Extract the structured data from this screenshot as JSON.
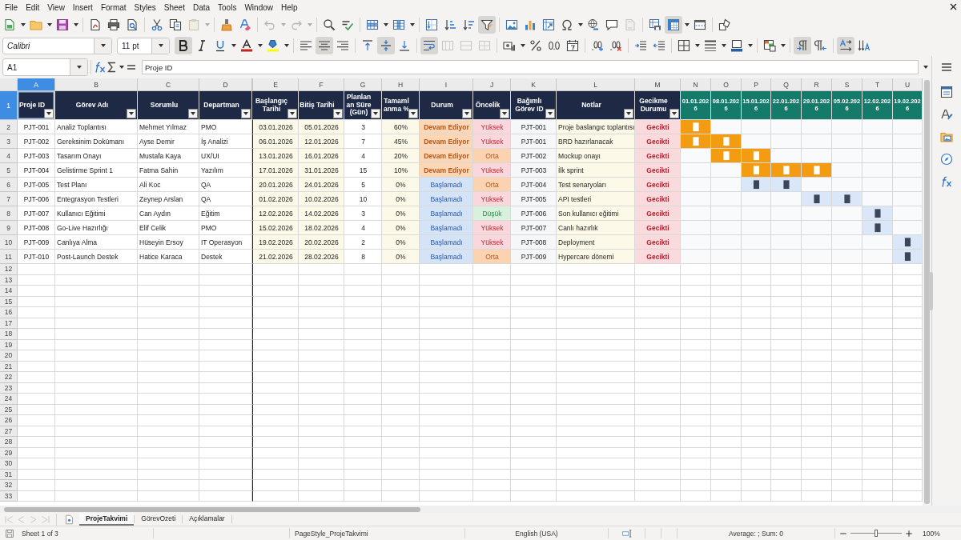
{
  "menu": [
    "File",
    "Edit",
    "View",
    "Insert",
    "Format",
    "Styles",
    "Sheet",
    "Data",
    "Tools",
    "Window",
    "Help"
  ],
  "standard_toolbar": {
    "paste_disabled": true,
    "undo_disabled": true,
    "redo_disabled": true,
    "header_footer_disabled": true,
    "autofilter_on": true,
    "freeze_on": true
  },
  "formatting_toolbar": {
    "font_name": "Calibri",
    "font_size": "11 pt",
    "bold_on": true,
    "align_center_on": true,
    "valign_middle_on": true,
    "wrap_text_on": true,
    "merge_disabled": true,
    "merge_center_disabled": true,
    "unmerge_disabled": true,
    "left_to_right_on": true,
    "text_flow_on": true
  },
  "formula_bar": {
    "name_box": "A1",
    "content": "Proje ID"
  },
  "sheet": {
    "column_headers": [
      {
        "label": "A",
        "selected": true
      },
      {
        "label": "B",
        "selected": false
      },
      {
        "label": "C",
        "selected": false
      },
      {
        "label": "D",
        "selected": false
      },
      {
        "label": "E",
        "selected": false
      },
      {
        "label": "F",
        "selected": false
      },
      {
        "label": "G",
        "selected": false
      },
      {
        "label": "H",
        "selected": false
      },
      {
        "label": "I",
        "selected": false
      },
      {
        "label": "J",
        "selected": false
      },
      {
        "label": "K",
        "selected": false
      },
      {
        "label": "L",
        "selected": false
      },
      {
        "label": "M",
        "selected": false
      },
      {
        "label": "N",
        "selected": false
      },
      {
        "label": "O",
        "selected": false
      },
      {
        "label": "P",
        "selected": false
      },
      {
        "label": "Q",
        "selected": false
      },
      {
        "label": "R",
        "selected": false
      },
      {
        "label": "S",
        "selected": false
      },
      {
        "label": "T",
        "selected": false
      },
      {
        "label": "U",
        "selected": false
      }
    ],
    "row_headers": [
      {
        "label": "1",
        "selected": true
      },
      {
        "label": "2",
        "selected": false
      },
      {
        "label": "3",
        "selected": false
      },
      {
        "label": "4",
        "selected": false
      },
      {
        "label": "5",
        "selected": false
      },
      {
        "label": "6",
        "selected": false
      },
      {
        "label": "7",
        "selected": false
      },
      {
        "label": "8",
        "selected": false
      },
      {
        "label": "9",
        "selected": false
      },
      {
        "label": "10",
        "selected": false
      },
      {
        "label": "11",
        "selected": false
      },
      {
        "label": "12",
        "selected": false
      },
      {
        "label": "13",
        "selected": false
      },
      {
        "label": "14",
        "selected": false
      },
      {
        "label": "15",
        "selected": false
      },
      {
        "label": "16",
        "selected": false
      },
      {
        "label": "17",
        "selected": false
      },
      {
        "label": "18",
        "selected": false
      },
      {
        "label": "19",
        "selected": false
      },
      {
        "label": "20",
        "selected": false
      },
      {
        "label": "21",
        "selected": false
      },
      {
        "label": "22",
        "selected": false
      },
      {
        "label": "23",
        "selected": false
      },
      {
        "label": "24",
        "selected": false
      },
      {
        "label": "25",
        "selected": false
      },
      {
        "label": "26",
        "selected": false
      },
      {
        "label": "27",
        "selected": false
      },
      {
        "label": "28",
        "selected": false
      },
      {
        "label": "29",
        "selected": false
      },
      {
        "label": "30",
        "selected": false
      },
      {
        "label": "31",
        "selected": false
      },
      {
        "label": "32",
        "selected": false
      },
      {
        "label": "33",
        "selected": false
      }
    ],
    "header_row": [
      {
        "text": "Proje ID",
        "kind": "field"
      },
      {
        "text": "Görev Adı",
        "kind": "field"
      },
      {
        "text": "Sorumlu",
        "kind": "field"
      },
      {
        "text": "Departman",
        "kind": "field"
      },
      {
        "text": "Başlangıç Tarihi",
        "kind": "field"
      },
      {
        "text": "Bitiş Tarihi",
        "kind": "field"
      },
      {
        "text": "Planlanan Süre (Gün)",
        "kind": "field"
      },
      {
        "text": "Tamamlanma %",
        "kind": "field"
      },
      {
        "text": "Durum",
        "kind": "field"
      },
      {
        "text": "Öncelik",
        "kind": "field"
      },
      {
        "text": "Bağımlı Görev ID",
        "kind": "field"
      },
      {
        "text": "Notlar",
        "kind": "field"
      },
      {
        "text": "Gecikme Durumu",
        "kind": "field"
      },
      {
        "text": "01.01.2026",
        "kind": "week"
      },
      {
        "text": "08.01.2026",
        "kind": "week"
      },
      {
        "text": "15.01.2026",
        "kind": "week"
      },
      {
        "text": "22.01.2026",
        "kind": "week"
      },
      {
        "text": "29.01.2026",
        "kind": "week"
      },
      {
        "text": "05.02.2026",
        "kind": "week"
      },
      {
        "text": "12.02.2026",
        "kind": "week"
      },
      {
        "text": "19.02.2026",
        "kind": "week"
      }
    ],
    "rows": [
      {
        "id": "PJT-001",
        "task": "Analiz Toplantısı",
        "owner": "Mehmet Yılmaz",
        "department": "PMO",
        "start": "03.01.2026",
        "end": "05.01.2026",
        "duration": "3",
        "progress": "60%",
        "status": {
          "text": "Devam Ediyor",
          "kind": "in_progress"
        },
        "priority": {
          "text": "Yüksek",
          "kind": "high"
        },
        "depends_on": "PJT-001",
        "note": "Proje baslangıc toplantısı",
        "delay": "Gecikti",
        "timeline": [
          {
            "filled": true,
            "text": "█"
          },
          {
            "filled": false
          },
          {
            "filled": false
          },
          {
            "filled": false
          },
          {
            "filled": false
          },
          {
            "filled": false
          },
          {
            "filled": false
          },
          {
            "filled": false
          }
        ]
      },
      {
        "id": "PJT-002",
        "task": "Gereksinim Dokümanı",
        "owner": "Ayse Demir",
        "department": "İş Analizi",
        "start": "06.01.2026",
        "end": "12.01.2026",
        "duration": "7",
        "progress": "45%",
        "status": {
          "text": "Devam Ediyor",
          "kind": "in_progress"
        },
        "priority": {
          "text": "Yüksek",
          "kind": "high"
        },
        "depends_on": "PJT-001",
        "note": "BRD hazırlanacak",
        "delay": "Gecikti",
        "timeline": [
          {
            "filled": true,
            "text": "█"
          },
          {
            "filled": true,
            "text": "█"
          },
          {
            "filled": false
          },
          {
            "filled": false
          },
          {
            "filled": false
          },
          {
            "filled": false
          },
          {
            "filled": false
          },
          {
            "filled": false
          }
        ]
      },
      {
        "id": "PJT-003",
        "task": "Tasarım Onayı",
        "owner": "Mustafa Kaya",
        "department": "UX/UI",
        "start": "13.01.2026",
        "end": "16.01.2026",
        "duration": "4",
        "progress": "20%",
        "status": {
          "text": "Devam Ediyor",
          "kind": "in_progress"
        },
        "priority": {
          "text": "Orta",
          "kind": "medium"
        },
        "depends_on": "PJT-002",
        "note": "Mockup onayı",
        "delay": "Gecikti",
        "timeline": [
          {
            "filled": false
          },
          {
            "filled": true,
            "text": "█"
          },
          {
            "filled": true,
            "text": "█"
          },
          {
            "filled": false
          },
          {
            "filled": false
          },
          {
            "filled": false
          },
          {
            "filled": false
          },
          {
            "filled": false
          }
        ]
      },
      {
        "id": "PJT-004",
        "task": "Gelistirme Sprint 1",
        "owner": "Fatma Sahin",
        "department": "Yazılım",
        "start": "17.01.2026",
        "end": "31.01.2026",
        "duration": "15",
        "progress": "10%",
        "status": {
          "text": "Devam Ediyor",
          "kind": "in_progress"
        },
        "priority": {
          "text": "Yüksek",
          "kind": "high"
        },
        "depends_on": "PJT-003",
        "note": "İlk sprint",
        "delay": "Gecikti",
        "timeline": [
          {
            "filled": false
          },
          {
            "filled": false
          },
          {
            "filled": true,
            "text": "█"
          },
          {
            "filled": true,
            "text": "█"
          },
          {
            "filled": true,
            "text": "█"
          },
          {
            "filled": false
          },
          {
            "filled": false
          },
          {
            "filled": false
          }
        ]
      },
      {
        "id": "PJT-005",
        "task": "Test Planı",
        "owner": "Ali Koc",
        "department": "QA",
        "start": "20.01.2026",
        "end": "24.01.2026",
        "duration": "5",
        "progress": "0%",
        "status": {
          "text": "Başlamadı",
          "kind": "not_started"
        },
        "priority": {
          "text": "Orta",
          "kind": "medium"
        },
        "depends_on": "PJT-004",
        "note": "Test senaryoları",
        "delay": "Gecikti",
        "timeline": [
          {
            "filled": false
          },
          {
            "filled": false
          },
          {
            "filled": true,
            "text": "█"
          },
          {
            "filled": true,
            "text": "█"
          },
          {
            "filled": false
          },
          {
            "filled": false
          },
          {
            "filled": false
          },
          {
            "filled": false
          }
        ]
      },
      {
        "id": "PJT-006",
        "task": "Entegrasyon Testleri",
        "owner": "Zeynep Arslan",
        "department": "QA",
        "start": "01.02.2026",
        "end": "10.02.2026",
        "duration": "10",
        "progress": "0%",
        "status": {
          "text": "Başlamadı",
          "kind": "not_started"
        },
        "priority": {
          "text": "Yüksek",
          "kind": "high"
        },
        "depends_on": "PJT-005",
        "note": "API testleri",
        "delay": "Gecikti",
        "timeline": [
          {
            "filled": false
          },
          {
            "filled": false
          },
          {
            "filled": false
          },
          {
            "filled": false
          },
          {
            "filled": true,
            "text": "█"
          },
          {
            "filled": true,
            "text": "█"
          },
          {
            "filled": false
          },
          {
            "filled": false
          }
        ]
      },
      {
        "id": "PJT-007",
        "task": "Kullanıcı Eğitimi",
        "owner": "Can Aydın",
        "department": "Eğitim",
        "start": "12.02.2026",
        "end": "14.02.2026",
        "duration": "3",
        "progress": "0%",
        "status": {
          "text": "Başlamadı",
          "kind": "not_started"
        },
        "priority": {
          "text": "Düşük",
          "kind": "low"
        },
        "depends_on": "PJT-006",
        "note": "Son kullanıcı eğitimi",
        "delay": "Gecikti",
        "timeline": [
          {
            "filled": false
          },
          {
            "filled": false
          },
          {
            "filled": false
          },
          {
            "filled": false
          },
          {
            "filled": false
          },
          {
            "filled": false
          },
          {
            "filled": true,
            "text": "█"
          },
          {
            "filled": false
          }
        ]
      },
      {
        "id": "PJT-008",
        "task": "Go-Live Hazırlığı",
        "owner": "Elif Celik",
        "department": "PMO",
        "start": "15.02.2026",
        "end": "18.02.2026",
        "duration": "4",
        "progress": "0%",
        "status": {
          "text": "Başlamadı",
          "kind": "not_started"
        },
        "priority": {
          "text": "Yüksek",
          "kind": "high"
        },
        "depends_on": "PJT-007",
        "note": "Canlı hazırlık",
        "delay": "Gecikti",
        "timeline": [
          {
            "filled": false
          },
          {
            "filled": false
          },
          {
            "filled": false
          },
          {
            "filled": false
          },
          {
            "filled": false
          },
          {
            "filled": false
          },
          {
            "filled": true,
            "text": "█"
          },
          {
            "filled": false
          }
        ]
      },
      {
        "id": "PJT-009",
        "task": "Canlıya Alma",
        "owner": "Hüseyin Ersoy",
        "department": "IT Operasyon",
        "start": "19.02.2026",
        "end": "20.02.2026",
        "duration": "2",
        "progress": "0%",
        "status": {
          "text": "Başlamadı",
          "kind": "not_started"
        },
        "priority": {
          "text": "Yüksek",
          "kind": "high"
        },
        "depends_on": "PJT-008",
        "note": "Deployment",
        "delay": "Gecikti",
        "timeline": [
          {
            "filled": false
          },
          {
            "filled": false
          },
          {
            "filled": false
          },
          {
            "filled": false
          },
          {
            "filled": false
          },
          {
            "filled": false
          },
          {
            "filled": false
          },
          {
            "filled": true,
            "text": "█"
          }
        ]
      },
      {
        "id": "PJT-010",
        "task": "Post-Launch Destek",
        "owner": "Hatice Karaca",
        "department": "Destek",
        "start": "21.02.2026",
        "end": "28.02.2026",
        "duration": "8",
        "progress": "0%",
        "status": {
          "text": "Başlamadı",
          "kind": "not_started"
        },
        "priority": {
          "text": "Orta",
          "kind": "medium"
        },
        "depends_on": "PJT-009",
        "note": "Hypercare dönemi",
        "delay": "Gecikti",
        "timeline": [
          {
            "filled": false
          },
          {
            "filled": false
          },
          {
            "filled": false
          },
          {
            "filled": false
          },
          {
            "filled": false
          },
          {
            "filled": false
          },
          {
            "filled": false
          },
          {
            "filled": true,
            "text": "█"
          }
        ]
      }
    ]
  },
  "sheet_tabs": [
    {
      "label": "ProjeTakvimi",
      "selected": true
    },
    {
      "label": "GörevOzeti",
      "selected": false
    },
    {
      "label": "Açıklamalar",
      "selected": false
    }
  ],
  "status_bar": {
    "sheet": "Sheet 1 of 3",
    "page_style": "PageStyle_ProjeTakvimi",
    "language": "English (USA)",
    "selection_summary": "Average: ; Sum: 0",
    "zoom": {
      "level": 0.5,
      "reading": "100%"
    }
  }
}
